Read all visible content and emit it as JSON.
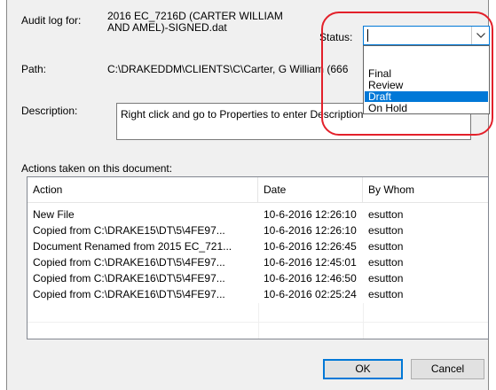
{
  "audit": {
    "label": "Audit log for:",
    "value": "2016 EC_7216D (CARTER WILLIAM AND AMEL)-SIGNED.dat"
  },
  "path": {
    "label": "Path:",
    "value": "C:\\DRAKEDDM\\CLIENTS\\C\\Carter, G William (666"
  },
  "description": {
    "label": "Description:",
    "value": "Right click and go to Properties to enter Description"
  },
  "status": {
    "label": "Status:",
    "current_value": "",
    "options": [
      "Final",
      "Review",
      "Draft",
      "On Hold"
    ],
    "highlighted": "Draft"
  },
  "actions": {
    "section_label": "Actions taken on this document:",
    "columns": [
      "Action",
      "Date",
      "By Whom"
    ],
    "rows": [
      [
        "New File",
        "10-6-2016 12:26:10",
        "esutton"
      ],
      [
        "Copied from C:\\DRAKE15\\DT\\5\\4FE97...",
        "10-6-2016 12:26:10",
        "esutton"
      ],
      [
        "Document Renamed from 2015 EC_721...",
        "10-6-2016 12:26:45",
        "esutton"
      ],
      [
        "Copied from C:\\DRAKE16\\DT\\5\\4FE97...",
        "10-6-2016 12:45:01",
        "esutton"
      ],
      [
        "Copied from C:\\DRAKE16\\DT\\5\\4FE97...",
        "10-6-2016 12:46:50",
        "esutton"
      ],
      [
        "Copied from C:\\DRAKE16\\DT\\5\\4FE97...",
        "10-6-2016 02:25:24",
        "esutton"
      ]
    ]
  },
  "buttons": {
    "ok": "OK",
    "cancel": "Cancel"
  },
  "colors": {
    "highlight": "#0078d7",
    "annotation_ring": "#e3202a"
  }
}
